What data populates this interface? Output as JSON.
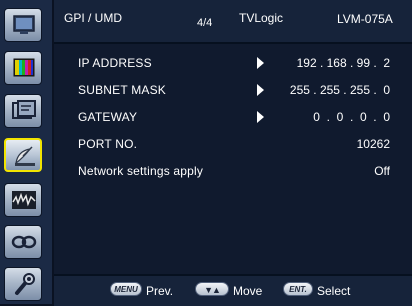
{
  "header": {
    "title": "GPI / UMD",
    "page": "4/4",
    "brand": "TVLogic",
    "model": "LVM-075A"
  },
  "sidebar": {
    "icons": [
      "monitor-icon",
      "color-bars-icon",
      "display-settings-icon",
      "satellite-dish-icon",
      "waveform-icon",
      "loop-icon",
      "wrench-icon"
    ],
    "active_index": 3
  },
  "settings": [
    {
      "label": "IP ADDRESS",
      "value": "192 . 168 . 99 .  2",
      "has_arrow": true
    },
    {
      "label": "SUBNET MASK",
      "value": "255 . 255 . 255 .  0",
      "has_arrow": true
    },
    {
      "label": "GATEWAY",
      "value": "0  .  0  .  0  .  0",
      "has_arrow": true
    },
    {
      "label": "PORT NO.",
      "value": "10262",
      "has_arrow": false
    },
    {
      "label": "Network settings apply",
      "value": "Off",
      "has_arrow": false
    }
  ],
  "footer": {
    "menu_key": "MENU",
    "prev_label": "Prev.",
    "move_key": "▼▲",
    "move_label": "Move",
    "ent_key": "ENT.",
    "select_label": "Select"
  },
  "colors": {
    "background": "#101a2e",
    "header": "#16233a",
    "active_highlight": "#f2e400",
    "text": "#ffffff"
  }
}
